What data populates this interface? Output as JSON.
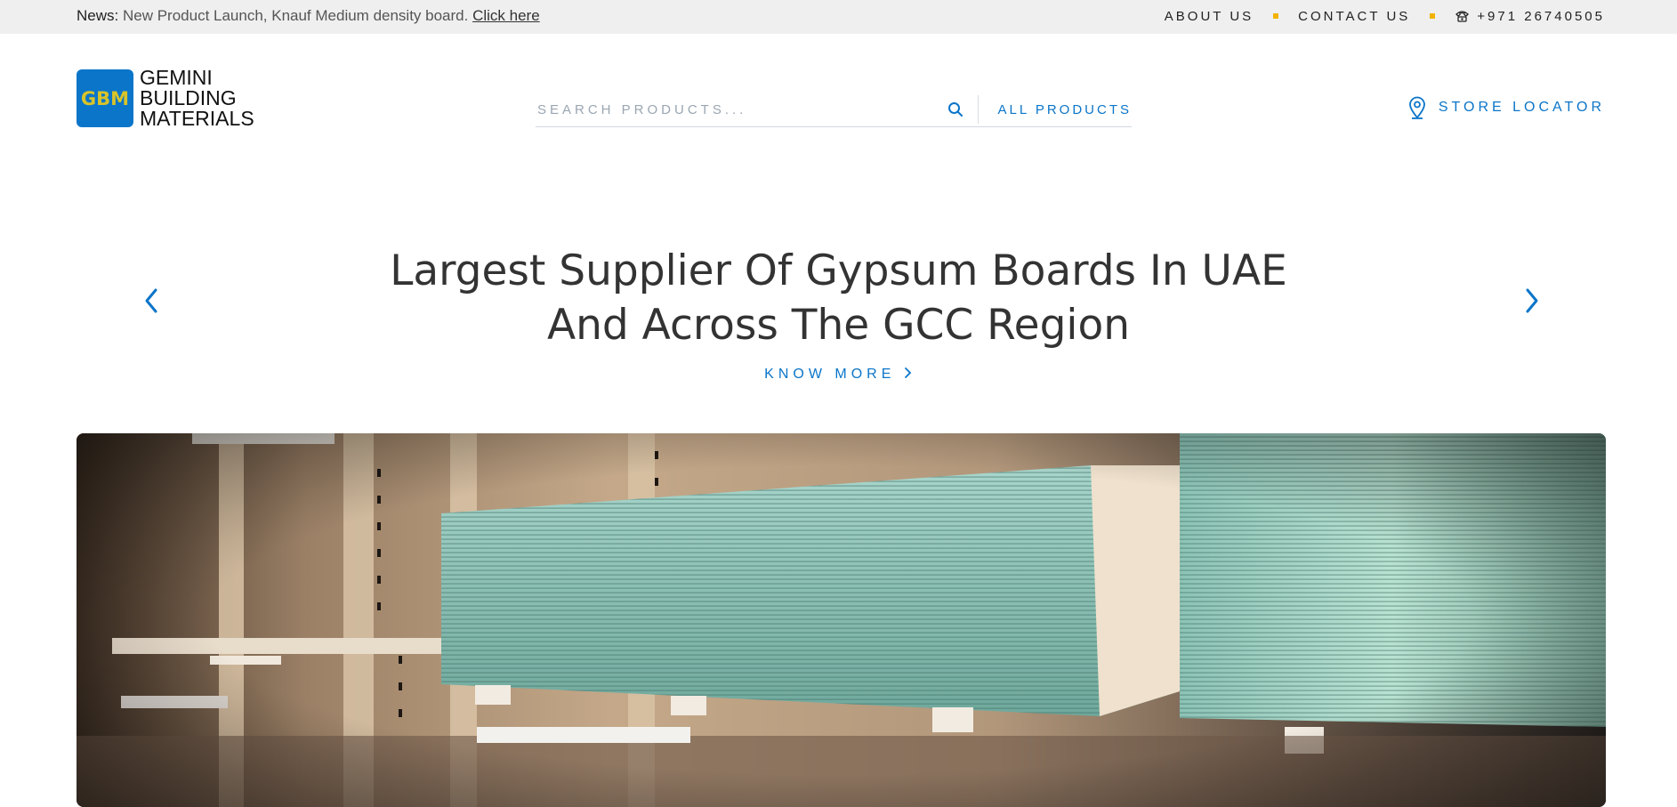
{
  "topbar": {
    "news_label": "News:",
    "news_text": "New Product Launch, Knauf Medium density board.",
    "news_link": "Click here",
    "about": "ABOUT US",
    "contact": "CONTACT US",
    "phone": "+971 26740505"
  },
  "header": {
    "logo_badge": "GBM",
    "logo_line1": "GEMINI",
    "logo_line2": "BUILDING",
    "logo_line3": "MATERIALS",
    "search_placeholder": "SEARCH PRODUCTS...",
    "all_products": "ALL PRODUCTS",
    "store_locator": "STORE LOCATOR"
  },
  "hero": {
    "title_line1": "Largest Supplier Of Gypsum Boards In UAE",
    "title_line2": "And Across The GCC Region",
    "cta": "KNOW MORE"
  },
  "icons": {
    "search": "search-icon",
    "phone": "phone-icon",
    "location": "location-pin-icon",
    "prev": "chevron-left-icon",
    "next": "chevron-right-icon",
    "cta": "chevron-right-icon"
  },
  "colors": {
    "accent": "#0b75c9",
    "dot": "#f0b400",
    "topbar_bg": "#efefef",
    "logo_text": "#d7c32a"
  }
}
